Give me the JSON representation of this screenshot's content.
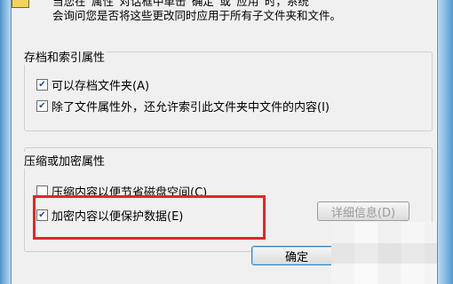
{
  "intro": {
    "line1": "当您在“属性”对话框中单击“确定”或“应用”时，系统",
    "line2": "会询问您是否将这些更改同时应用于所有子文件夹和文件。"
  },
  "archive_group": {
    "title": "存档和索引属性",
    "items": [
      {
        "label": "可以存档文件夹(A)",
        "checked": true
      },
      {
        "label": "除了文件属性外，还允许索引此文件夹中文件的内容(I)",
        "checked": true
      }
    ]
  },
  "compress_group": {
    "title": "压缩或加密属性",
    "items": [
      {
        "label": "压缩内容以便节省磁盘空间(C)",
        "checked": false
      },
      {
        "label": "加密内容以便保护数据(E)",
        "checked": true
      }
    ],
    "details_button": "详细信息(D)"
  },
  "footer": {
    "ok_button": "确定"
  },
  "colors": {
    "highlight": "#e0262b",
    "dialog_bg": "#f0f0f0"
  }
}
